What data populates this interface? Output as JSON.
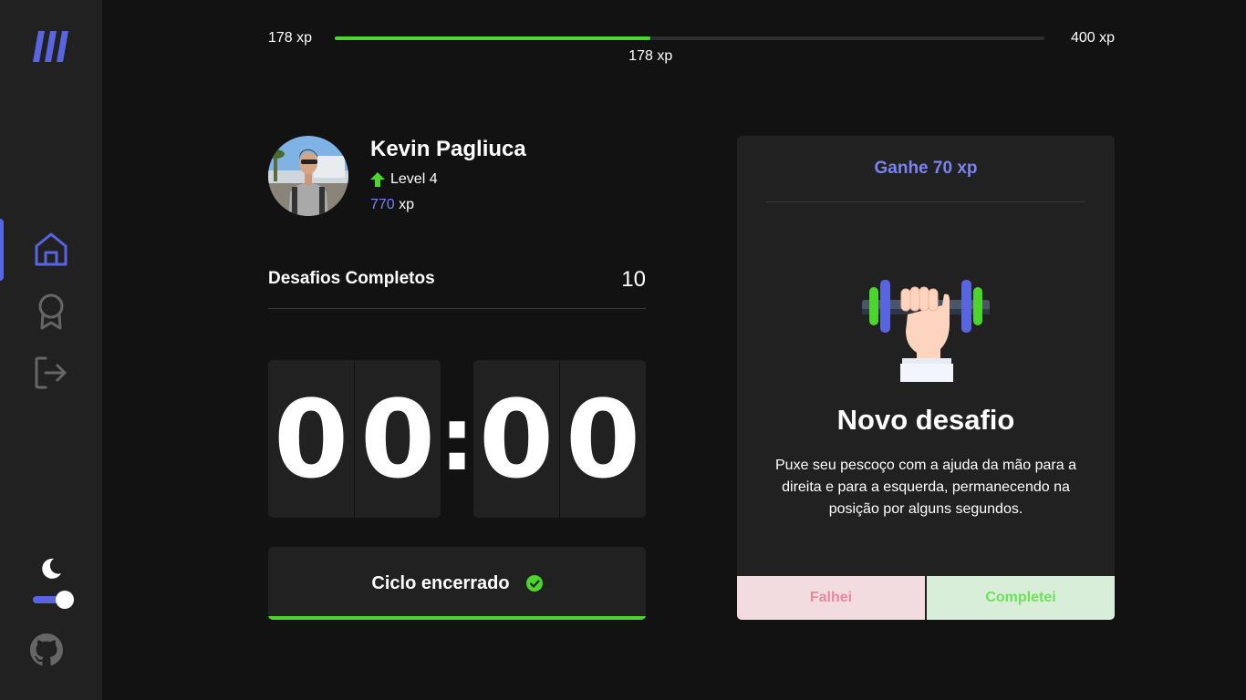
{
  "colors": {
    "background": "#121212",
    "surface": "#212121",
    "accent": "#5965e0",
    "accent_text": "#7b83f0",
    "success": "#4cd62b",
    "fail_bg": "#f3dcdf",
    "fail_text": "#e98a9c",
    "done_bg": "#d9eed9",
    "done_text": "#6be25a"
  },
  "sidebar": {
    "logo_icon": "moveit-logo-icon",
    "items": [
      {
        "icon": "home-icon",
        "active": true
      },
      {
        "icon": "award-icon",
        "active": false
      },
      {
        "icon": "logout-icon",
        "active": false
      }
    ],
    "theme_icon": "moon-icon",
    "theme_dark_mode": true,
    "github_icon": "github-icon"
  },
  "experience": {
    "min_label": "178 xp",
    "max_label": "400 xp",
    "current_label": "178 xp",
    "progress_fraction": 0.445
  },
  "profile": {
    "name": "Kevin Pagliuca",
    "level_label": "Level 4",
    "total_xp": "770",
    "xp_unit": "xp"
  },
  "completed_challenges": {
    "label": "Desafios Completos",
    "count": "10"
  },
  "countdown": {
    "minute_left": "0",
    "minute_right": "0",
    "separator": ":",
    "second_left": "0",
    "second_right": "0"
  },
  "cycle": {
    "label": "Ciclo encerrado",
    "icon": "check-circle-icon"
  },
  "challenge": {
    "reward": "Ganhe 70 xp",
    "image_icon": "dumbbell-icon",
    "title": "Novo desafio",
    "description": "Puxe seu pescoço com a ajuda da mão para a direita e para a esquerda, permanecendo na posição por alguns segundos.",
    "fail_label": "Falhei",
    "complete_label": "Completei"
  }
}
